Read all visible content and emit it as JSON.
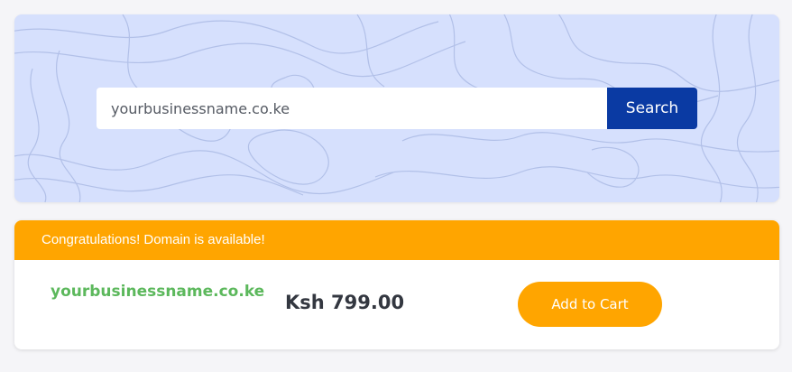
{
  "search": {
    "value": "yourbusinessname.co.ke",
    "button_label": "Search"
  },
  "result": {
    "banner_text": "Congratulations! Domain is available!",
    "domain": "yourbusinessname.co.ke",
    "price": "Ksh 799.00",
    "cart_label": "Add to Cart"
  },
  "colors": {
    "panel_background": "#d6e0fd",
    "search_button": "#0a3aa3",
    "accent_orange": "#ffa500",
    "available_green": "#5cb85c",
    "price_text": "#333740"
  }
}
